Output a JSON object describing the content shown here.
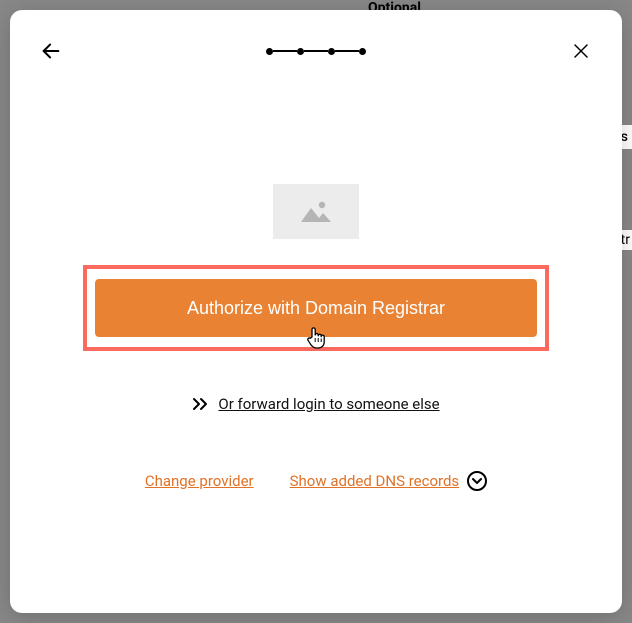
{
  "bg": {
    "t1": "Optional",
    "t2": "ts",
    "t3": "atr"
  },
  "actions": {
    "authorize_label": "Authorize with Domain Registrar",
    "forward_label": "Or forward login to someone else",
    "change_provider_label": "Change provider",
    "show_dns_label": "Show added DNS records"
  }
}
